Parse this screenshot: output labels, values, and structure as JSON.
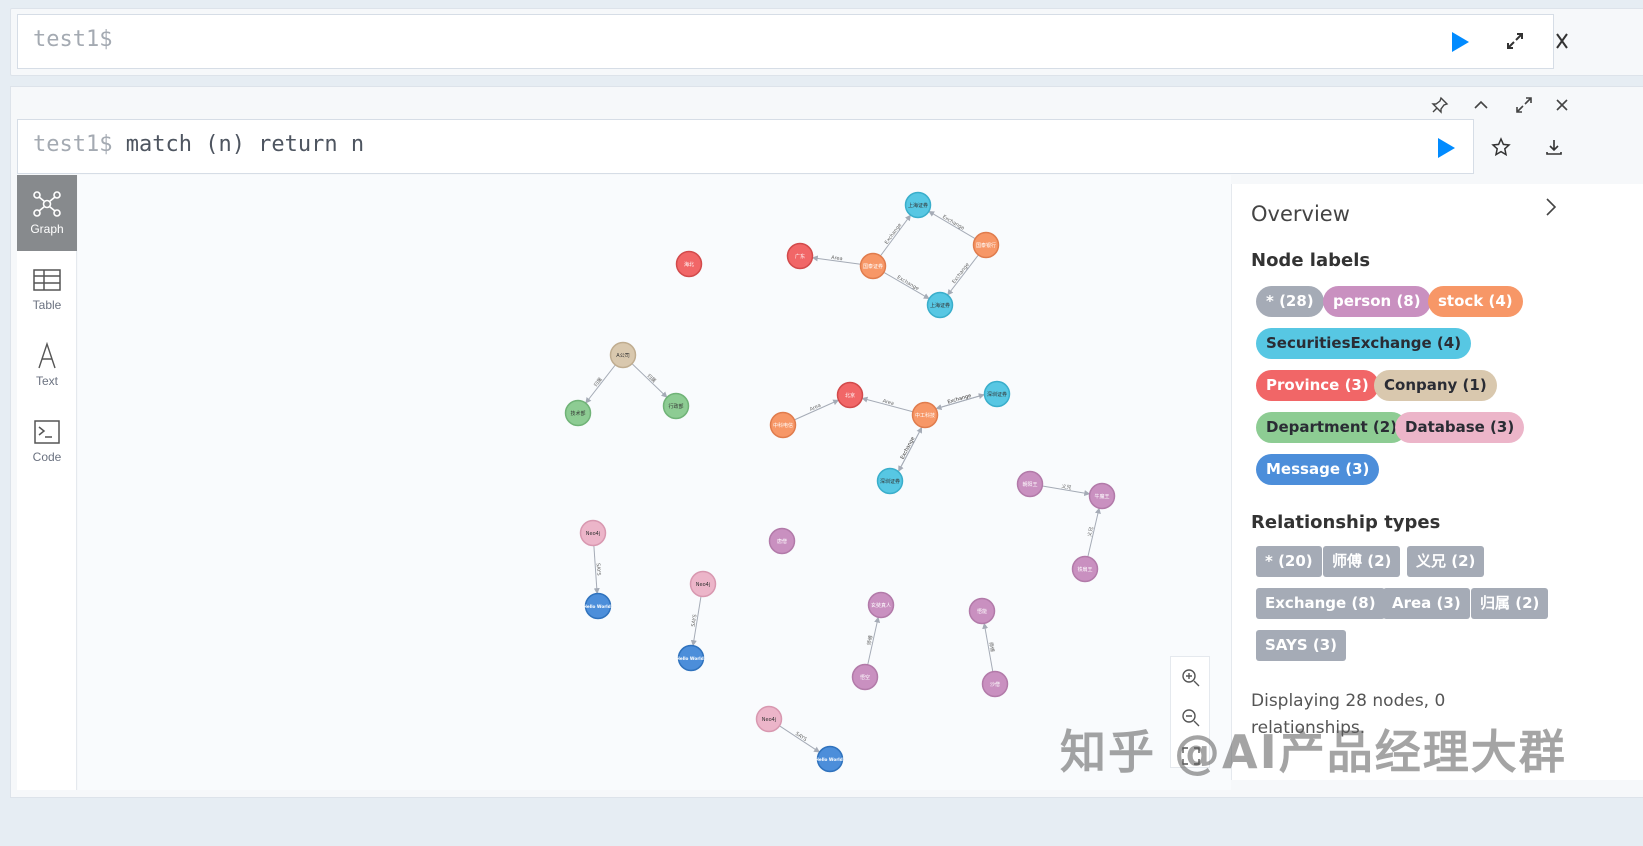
{
  "top_editor": {
    "prompt": "test1$",
    "query": ""
  },
  "result_frame": {
    "prompt": "test1$",
    "query": "match (n) return n",
    "toolbar_icons": [
      "pin-icon",
      "collapse-up-icon",
      "expand-icon",
      "close-icon"
    ]
  },
  "nav": [
    {
      "label": "Graph",
      "icon": "graph-icon",
      "active": true
    },
    {
      "label": "Table",
      "icon": "table-icon",
      "active": false
    },
    {
      "label": "Text",
      "icon": "text-icon",
      "active": false
    },
    {
      "label": "Code",
      "icon": "code-icon",
      "active": false
    }
  ],
  "colors": {
    "person": "#c990c0",
    "stock": "#f79767",
    "securities": "#57c7e3",
    "province": "#f16667",
    "company": "#d9c8ae",
    "department": "#8dcc93",
    "database": "#ecb5c9",
    "message": "#4c8eda",
    "all": "#a5abb6",
    "run": "#018bff"
  },
  "graph": {
    "nodes": [
      {
        "id": "n1",
        "label": "上海证券",
        "type": "securities"
      },
      {
        "id": "n2",
        "label": "国泰银行",
        "type": "stock"
      },
      {
        "id": "n3",
        "label": "国泰证券",
        "type": "stock"
      },
      {
        "id": "n4",
        "label": "上海证券",
        "type": "securities"
      },
      {
        "id": "n5",
        "label": "广东",
        "type": "province"
      },
      {
        "id": "n6",
        "label": "海北",
        "type": "province"
      },
      {
        "id": "n7",
        "label": "A公司",
        "type": "company"
      },
      {
        "id": "n8",
        "label": "技术部",
        "type": "department"
      },
      {
        "id": "n9",
        "label": "行政部",
        "type": "department"
      },
      {
        "id": "n10",
        "label": "北京",
        "type": "province"
      },
      {
        "id": "n11",
        "label": "中科电信",
        "type": "stock"
      },
      {
        "id": "n12",
        "label": "中工科技",
        "type": "stock"
      },
      {
        "id": "n13",
        "label": "深圳证券",
        "type": "securities"
      },
      {
        "id": "n14",
        "label": "深圳证券",
        "type": "securities"
      },
      {
        "id": "n15",
        "label": "朝阳王",
        "type": "person"
      },
      {
        "id": "n16",
        "label": "牛魔王",
        "type": "person"
      },
      {
        "id": "n17",
        "label": "铁扇王",
        "type": "person"
      },
      {
        "id": "n18",
        "label": "Neo4j",
        "type": "database"
      },
      {
        "id": "n19",
        "label": "Hello World!",
        "type": "message"
      },
      {
        "id": "n20",
        "label": "唐僧",
        "type": "person"
      },
      {
        "id": "n21",
        "label": "Neo4j",
        "type": "database"
      },
      {
        "id": "n22",
        "label": "Hello World!",
        "type": "message"
      },
      {
        "id": "n23",
        "label": "玄奘真人",
        "type": "person"
      },
      {
        "id": "n24",
        "label": "悟空",
        "type": "person"
      },
      {
        "id": "n25",
        "label": "悟能",
        "type": "person"
      },
      {
        "id": "n26",
        "label": "沙僧",
        "type": "person"
      },
      {
        "id": "n27",
        "label": "Neo4j",
        "type": "database"
      },
      {
        "id": "n28",
        "label": "Hello World!",
        "type": "message"
      }
    ],
    "edges": [
      {
        "from": "n3",
        "to": "n1",
        "label": "Exchange"
      },
      {
        "from": "n2",
        "to": "n1",
        "label": "Exchange"
      },
      {
        "from": "n2",
        "to": "n4",
        "label": "Exchange"
      },
      {
        "from": "n3",
        "to": "n4",
        "label": "Exchange"
      },
      {
        "from": "n3",
        "to": "n5",
        "label": "Area"
      },
      {
        "from": "n7",
        "to": "n8",
        "label": "归属"
      },
      {
        "from": "n7",
        "to": "n9",
        "label": "归属"
      },
      {
        "from": "n11",
        "to": "n10",
        "label": "Area"
      },
      {
        "from": "n12",
        "to": "n10",
        "label": "Area"
      },
      {
        "from": "n12",
        "to": "n13",
        "label": "Exchange"
      },
      {
        "from": "n13",
        "to": "n12",
        "label": "Exchange"
      },
      {
        "from": "n12",
        "to": "n14",
        "label": "Exchange"
      },
      {
        "from": "n14",
        "to": "n12",
        "label": "Exchange"
      },
      {
        "from": "n15",
        "to": "n16",
        "label": "义兄"
      },
      {
        "from": "n17",
        "to": "n16",
        "label": "义兄"
      },
      {
        "from": "n18",
        "to": "n19",
        "label": "SAYS"
      },
      {
        "from": "n21",
        "to": "n22",
        "label": "SAYS"
      },
      {
        "from": "n24",
        "to": "n23",
        "label": "师傅"
      },
      {
        "from": "n26",
        "to": "n25",
        "label": "师傅"
      },
      {
        "from": "n27",
        "to": "n28",
        "label": "SAYS"
      }
    ]
  },
  "overview": {
    "title": "Overview",
    "node_labels_title": "Node labels",
    "node_labels": [
      {
        "text": "* (28)",
        "type": "all"
      },
      {
        "text": "person (8)",
        "type": "person"
      },
      {
        "text": "stock (4)",
        "type": "stock"
      },
      {
        "text": "SecuritiesExchange (4)",
        "type": "securities"
      },
      {
        "text": "Province (3)",
        "type": "province"
      },
      {
        "text": "Conpany (1)",
        "type": "company"
      },
      {
        "text": "Department (2)",
        "type": "department"
      },
      {
        "text": "Database (3)",
        "type": "database"
      },
      {
        "text": "Message (3)",
        "type": "message"
      }
    ],
    "rel_types_title": "Relationship types",
    "rel_types": [
      "* (20)",
      "师傅 (2)",
      "义兄 (2)",
      "Exchange (8)",
      "Area (3)",
      "归属 (2)",
      "SAYS (3)"
    ],
    "footer": "Displaying 28 nodes, 0 relationships."
  },
  "watermark": "知乎 @AI产品经理大群"
}
